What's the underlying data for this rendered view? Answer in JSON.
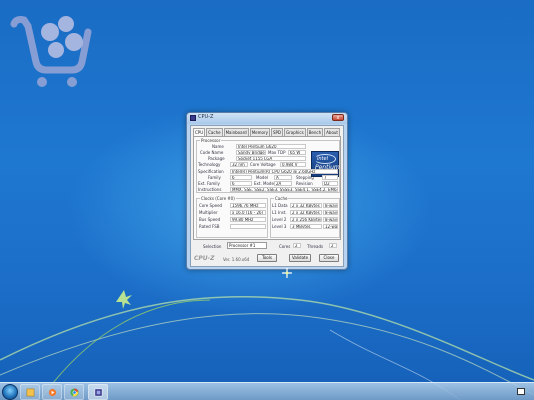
{
  "window": {
    "title": "CPU-Z",
    "close_label": "x"
  },
  "tabs": [
    {
      "label": "CPU"
    },
    {
      "label": "Cache"
    },
    {
      "label": "Mainboard"
    },
    {
      "label": "Memory"
    },
    {
      "label": "SPD"
    },
    {
      "label": "Graphics"
    },
    {
      "label": "Bench"
    },
    {
      "label": "About"
    }
  ],
  "processor": {
    "group_title": "Processor",
    "name_label": "Name",
    "name_value": "Intel Pentium G620",
    "codename_label": "Code Name",
    "codename_value": "Sandy Bridge",
    "maxtdp_label": "Max TDP",
    "maxtdp_value": "65 W",
    "package_label": "Package",
    "package_value": "Socket 1155 LGA",
    "technology_label": "Technology",
    "technology_value": "32 nm",
    "voltage_label": "Core Voltage",
    "voltage_value": "0.984 V",
    "spec_label": "Specification",
    "spec_value": "Intel(R) Pentium(R) CPU G620 @ 2.60GHz",
    "family_label": "Family",
    "family_value": "6",
    "model_label": "Model",
    "model_value": "A",
    "stepping_label": "Stepping",
    "stepping_value": "7",
    "extfamily_label": "Ext. Family",
    "extfamily_value": "6",
    "extmodel_label": "Ext. Model",
    "extmodel_value": "2A",
    "revision_label": "Revision",
    "revision_value": "D2",
    "instr_label": "Instructions",
    "instr_value": "MMX, SSE, SSE2, SSE3, SSSE3, SSE4.1, SSE4.2, EM64T"
  },
  "intel_logo": {
    "brand": "intel",
    "product": "Pentium",
    "tag": "inside"
  },
  "clocks": {
    "group_title": "Clocks (Core #0)",
    "core_speed_label": "Core Speed",
    "core_speed_value": "1596.76 MHz",
    "multiplier_label": "Multiplier",
    "multiplier_value": "x 16.0 (16 - 26)",
    "bus_speed_label": "Bus Speed",
    "bus_speed_value": "99.80 MHz",
    "rated_fsb_label": "Rated FSB",
    "rated_fsb_value": ""
  },
  "cache": {
    "group_title": "Cache",
    "l1d_label": "L1 Data",
    "l1d_value": "2 x 32 KBytes",
    "l1d_way": "8-way",
    "l1i_label": "L1 Inst.",
    "l1i_value": "2 x 32 KBytes",
    "l1i_way": "8-way",
    "l2_label": "Level 2",
    "l2_value": "2 x 256 KBytes",
    "l2_way": "8-way",
    "l3_label": "Level 3",
    "l3_value": "3 MBytes",
    "l3_way": "12-way"
  },
  "selection": {
    "label": "Selection",
    "value": "Processor #1",
    "cores_label": "Cores",
    "cores_value": "2",
    "threads_label": "Threads",
    "threads_value": "2"
  },
  "footer": {
    "brand": "CPU-Z",
    "version": "Ver. 1.60.x64",
    "tools_label": "Tools",
    "validate_label": "Validate",
    "ok_label": "Close"
  },
  "colors": {
    "desktop_blue": "#1f78d0",
    "window_frame": "#b7d3ef",
    "swirl_green": "#a8e05a"
  }
}
